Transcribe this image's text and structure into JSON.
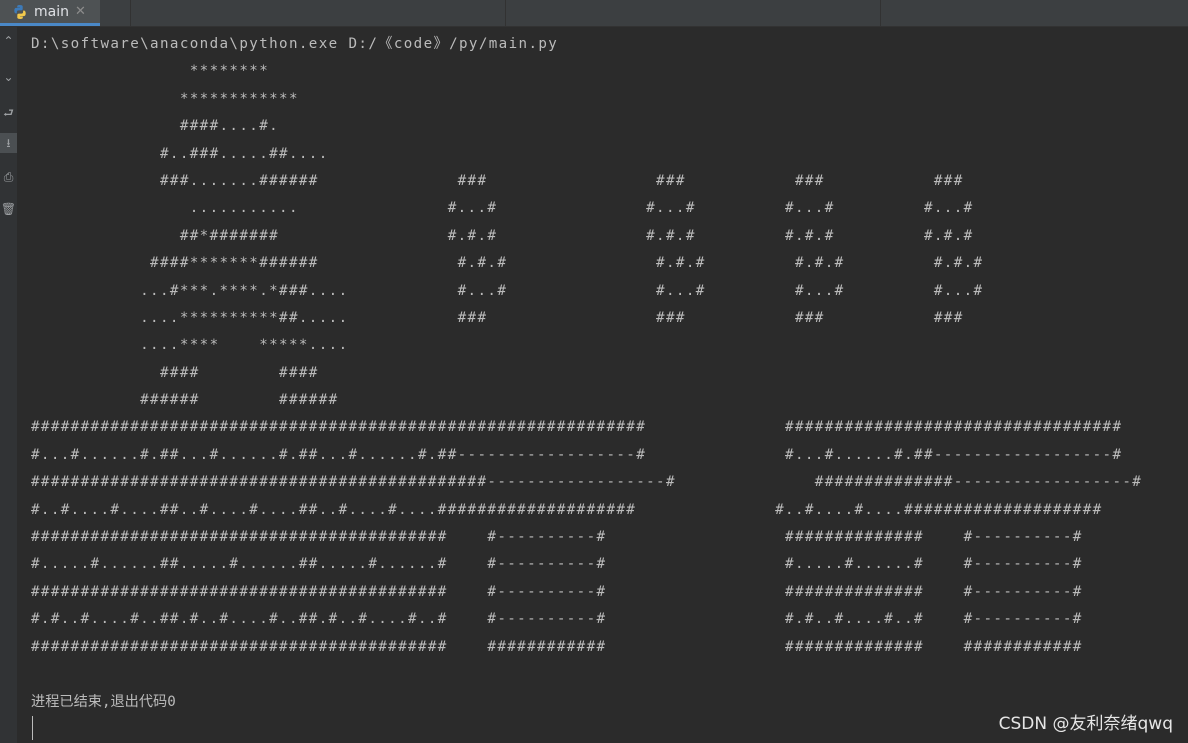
{
  "tab": {
    "label": "main",
    "close": "✕"
  },
  "gutter_icons": [
    "chevron-up-icon",
    "chevron-down-icon",
    "soft-wrap-icon",
    "scroll-to-end-icon",
    "print-icon",
    "trash-icon"
  ],
  "console": {
    "lines": [
      "D:\\software\\anaconda\\python.exe D:/《code》/py/main.py",
      "                ********",
      "               ************",
      "               ####....#.",
      "             #..###.....##....",
      "             ###.......######              ###                 ###           ###           ###",
      "                ...........               #...#               #...#         #...#         #...#",
      "               ##*#######                 #.#.#               #.#.#         #.#.#         #.#.#",
      "            ####*******######              #.#.#               #.#.#         #.#.#         #.#.#",
      "           ...#***.****.*###....           #...#               #...#         #...#         #...#",
      "           ....**********##.....           ###                 ###           ###           ###",
      "           ....****    *****....",
      "             ####        ####",
      "           ######        ######",
      "##############################################################              ##################################",
      "#...#......#.##...#......#.##...#......#.##------------------#              #...#......#.##------------------#",
      "##############################################------------------#              ##############------------------#",
      "#..#....#....##..#....#....##..#....#....####################              #..#....#....####################",
      "##########################################    #----------#                  ##############    #----------#",
      "#.....#......##.....#......##.....#......#    #----------#                  #.....#......#    #----------#",
      "##########################################    #----------#                  ##############    #----------#",
      "#.#..#....#..##.#..#....#..##.#..#....#..#    #----------#                  #.#..#....#..#    #----------#",
      "##########################################    ############                  ##############    ############"
    ],
    "exit_message": "进程已结束,退出代码0"
  },
  "watermark": "CSDN @友利奈绪qwq",
  "colors": {
    "background": "#2b2b2b",
    "text": "#bbbbbb",
    "tabbar": "#3c3f41",
    "accent": "#4a88c7"
  }
}
